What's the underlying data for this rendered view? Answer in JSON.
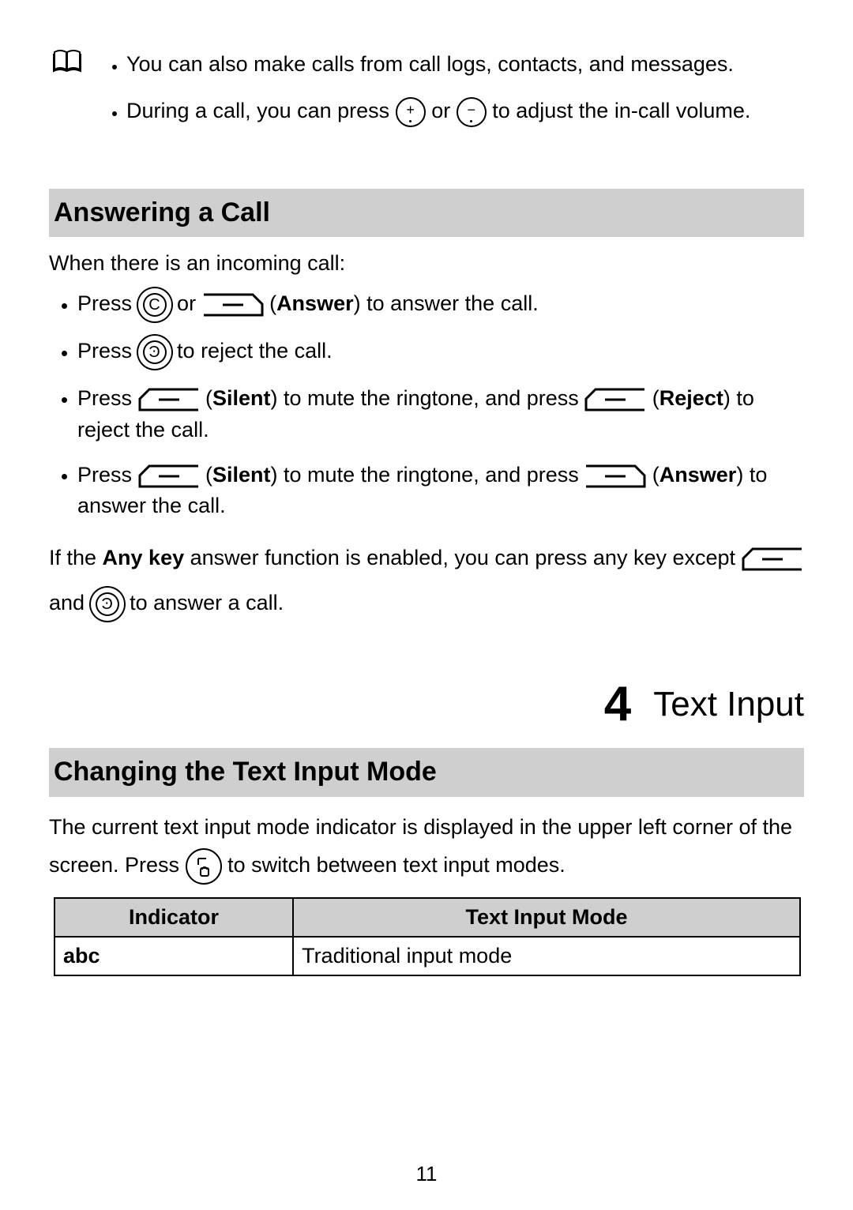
{
  "note": {
    "items": [
      "You can also make calls from call logs, contacts, and messages.",
      {
        "pre": "During a call, you can press ",
        "mid": " or ",
        "post": " to adjust the in-call volume."
      }
    ]
  },
  "answering": {
    "heading": "Answering a Call",
    "intro": "When there is an incoming call:",
    "items": [
      {
        "pre": "Press ",
        "mid": " or ",
        "label": "Answer",
        "post": ") to answer the call."
      },
      {
        "pre": "Press ",
        "post": " to reject the call."
      },
      {
        "pre": "Press ",
        "label1": "Silent",
        "mid": ") to mute the ringtone, and press ",
        "label2": "Reject",
        "post": ") to reject the call."
      },
      {
        "pre": "Press ",
        "label1": "Silent",
        "mid": ") to mute the ringtone, and press ",
        "label2": "Answer",
        "post": ") to answer the call."
      }
    ],
    "anykey": {
      "pre": "If the ",
      "bold": "Any key",
      "mid1": " answer function is enabled, you can press any key except ",
      "mid2": " and ",
      "post": " to answer a call."
    }
  },
  "chapter": {
    "number": "4",
    "title": "Text Input"
  },
  "changing": {
    "heading": "Changing the Text Input Mode",
    "para_pre": "The current text input mode indicator is displayed in the upper left corner of the screen. Press ",
    "para_post": " to switch between text input modes.",
    "table": {
      "head": [
        "Indicator",
        "Text Input Mode"
      ],
      "rows": [
        [
          "abc",
          "Traditional input mode"
        ]
      ]
    }
  },
  "page_number": "11"
}
